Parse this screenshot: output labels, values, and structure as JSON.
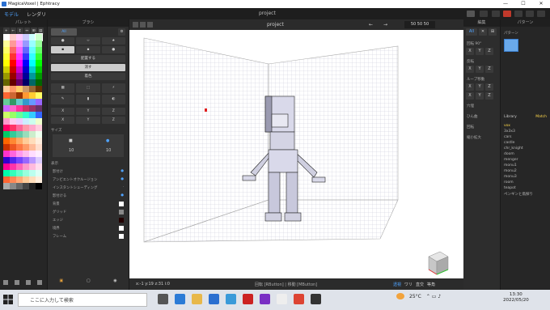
{
  "window": {
    "title": "MagicaVoxel | Ephtracy",
    "min": "—",
    "max": "☐",
    "close": "✕"
  },
  "modes": [
    "モデル",
    "レンダリ"
  ],
  "project_title": "project",
  "palette": {
    "header": "パレット",
    "tabs": [
      "+",
      "←",
      "↕",
      "↔",
      "⊞",
      "▤"
    ],
    "colors": [
      "#ffffff",
      "#ffcccc",
      "#ffccff",
      "#ccccff",
      "#ccffff",
      "#ccffcc",
      "#ffff99",
      "#ff9999",
      "#ff99ff",
      "#9999ff",
      "#99ffff",
      "#99ff99",
      "#ffff66",
      "#ff6666",
      "#ff66ff",
      "#6666ff",
      "#66ffff",
      "#66ff66",
      "#ffff33",
      "#ff3333",
      "#ff33ff",
      "#3333ff",
      "#33ffff",
      "#33ff33",
      "#ffff00",
      "#ff0000",
      "#ff00ff",
      "#0000ff",
      "#00ffff",
      "#00ff00",
      "#cccc00",
      "#cc0000",
      "#cc00cc",
      "#0000cc",
      "#00cccc",
      "#00cc00",
      "#999900",
      "#990000",
      "#990099",
      "#000099",
      "#009999",
      "#009900",
      "#666600",
      "#660000",
      "#660066",
      "#000066",
      "#006666",
      "#006600",
      "#ffcc99",
      "#ff9966",
      "#ffcc66",
      "#cc9966",
      "#996633",
      "#663300",
      "#ff6633",
      "#cc6633",
      "#993300",
      "#ff9933",
      "#ffcc33",
      "#ffff66",
      "#66cc99",
      "#339966",
      "#66cccc",
      "#3399cc",
      "#6699ff",
      "#9966ff",
      "#cc66ff",
      "#ff66cc",
      "#ff3399",
      "#cc3366",
      "#993366",
      "#663366",
      "#ccff66",
      "#99ff66",
      "#66ff99",
      "#33ffcc",
      "#33ccff",
      "#3366ff",
      "#ff99cc",
      "#ffccee",
      "#eeccff",
      "#cceeff",
      "#ccffee",
      "#eeffcc",
      "#ff0066",
      "#ff3366",
      "#ff6699",
      "#ff99aa",
      "#ffaacc",
      "#ffccdd",
      "#00cc66",
      "#33cc99",
      "#66ccaa",
      "#99ddbb",
      "#cceecc",
      "#eeffee",
      "#ff6600",
      "#ff8833",
      "#ffaa66",
      "#ffcc99",
      "#ffddbb",
      "#ffeedd",
      "#cc3300",
      "#ee5522",
      "#ff7744",
      "#ff9966",
      "#ffbb99",
      "#ffddcc",
      "#ff33cc",
      "#ff66dd",
      "#ff99ee",
      "#ffbbee",
      "#ffddff",
      "#ffeeff",
      "#3300cc",
      "#5522ee",
      "#7744ff",
      "#9966ff",
      "#bb99ff",
      "#ddccff",
      "#ff0099",
      "#ff33aa",
      "#ff66bb",
      "#ff99cc",
      "#ffbbdd",
      "#ffddee",
      "#00ffaa",
      "#33ffbb",
      "#66ffcc",
      "#99ffdd",
      "#bbffee",
      "#ddfff5",
      "#ff6633",
      "#ff8855",
      "#ffaa77",
      "#ffcc99",
      "#ffddbb",
      "#ffeedd",
      "#aaaaaa",
      "#888888",
      "#666666",
      "#444444",
      "#222222",
      "#000000"
    ],
    "footer_icons": [
      "add-icon",
      "copy-icon",
      "save-icon",
      "file-icon"
    ]
  },
  "brush": {
    "header": "ブラシ",
    "all_label": "All",
    "mode_buttons": [
      "配置する",
      "消す",
      "着色"
    ],
    "section_mirror": "ミラー",
    "mirror_axes": [
      "X",
      "Y",
      "Z"
    ],
    "section_size": "サイズ",
    "size_values": [
      "10",
      "10"
    ],
    "section_display": "表示",
    "display_options": [
      "影付け",
      "アンビエントオクルージョン",
      "インスタントシェーディング",
      "影付ける",
      "背景",
      "グリッド",
      "エッジ",
      "境界",
      "フレーム"
    ],
    "display_colors": {
      "bg": "#ffffff",
      "grid": "#888888",
      "edge": "#220000",
      "frame": "#000000"
    }
  },
  "viewport": {
    "project": "project",
    "size_readout": "50  50  50",
    "coords": "x:-1   y:19   z:31   i:0",
    "hint": "回転 [RButton] | 移動 [MButton]",
    "bottom_tools": [
      "透視",
      "ワリ",
      "直交",
      "等角"
    ]
  },
  "edit_panel": {
    "header": "編集",
    "all_label": "All",
    "sections": [
      "回転 90°",
      "反転",
      "ループ移動",
      "穴埋",
      "ひん曲",
      "回転",
      "縮小拡大"
    ]
  },
  "pattern_panel": {
    "header": "パターン",
    "pattern_label": "パターン",
    "library_tab": "Library",
    "match_tab": "Match",
    "items": [
      "vox",
      "3x3x3",
      "cars",
      "castle",
      "chr_knight",
      "doom",
      "menger",
      "monu1",
      "monu2",
      "monu3",
      "room",
      "teapot",
      "ペンギンと鳥探り"
    ],
    "selected_index": 0
  },
  "taskbar": {
    "search_placeholder": "ここに入力して検索",
    "weather": "25°C",
    "time": "13:30",
    "date": "2022/05/20"
  }
}
